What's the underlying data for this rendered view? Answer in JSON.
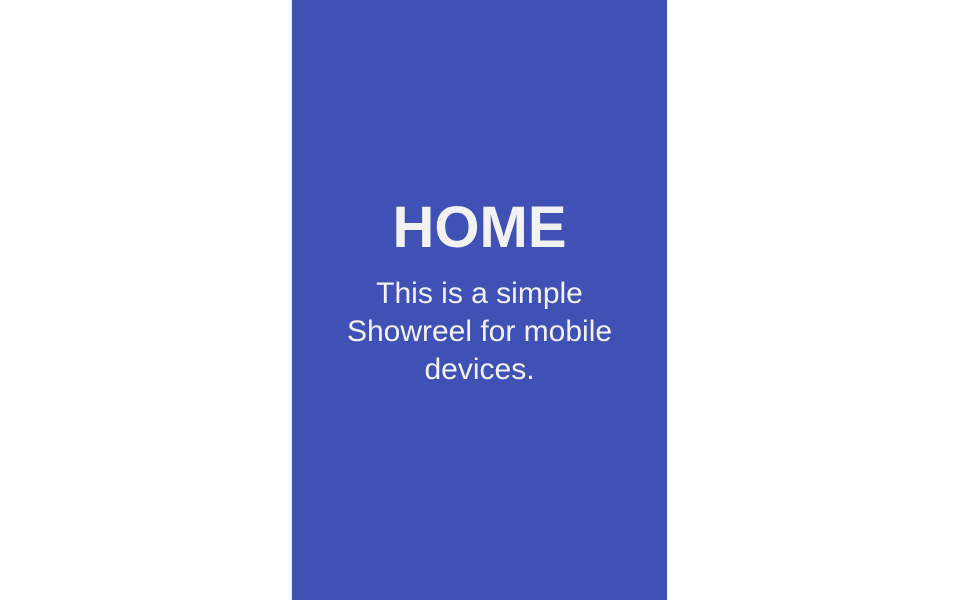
{
  "slide": {
    "title": "HOME",
    "description": "This is a simple Showreel for mobile devices.",
    "background_color": "#3f51b5",
    "text_color": "#f2f2f2"
  }
}
